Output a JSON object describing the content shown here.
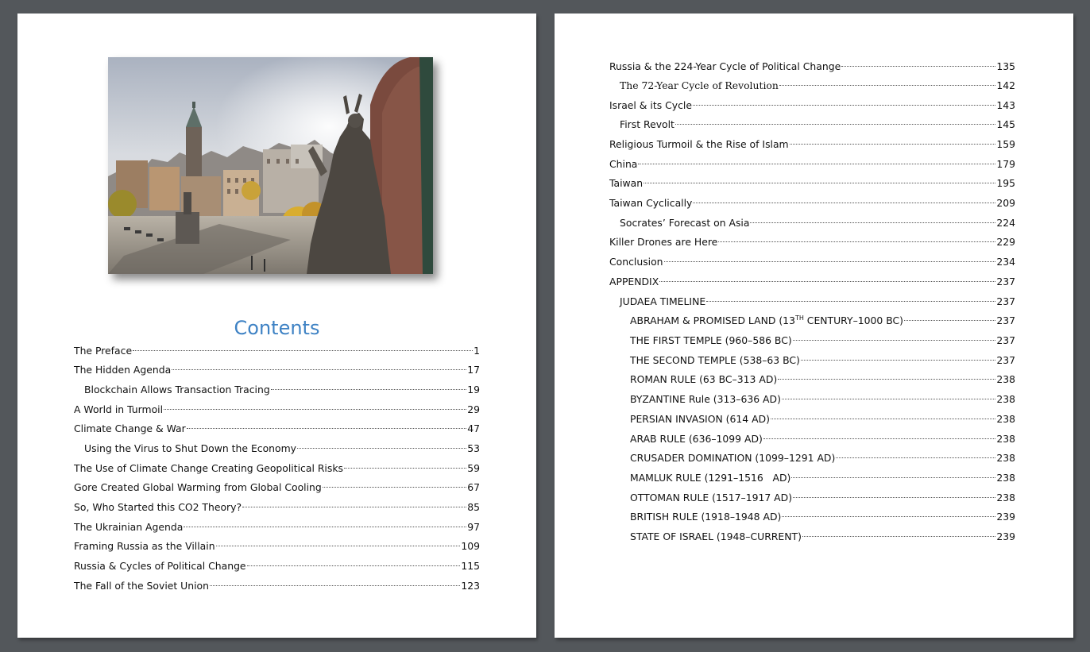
{
  "left_page": {
    "cover_image": "city-statue-photo",
    "contents_title": "Contents",
    "entries": [
      {
        "title": "The Preface",
        "page": "1"
      },
      {
        "title": "The Hidden Agenda",
        "page": "17"
      },
      {
        "title": "Blockchain Allows Transaction Tracing",
        "page": "19"
      },
      {
        "title": "A World in Turmoil",
        "page": "29"
      },
      {
        "title": "Climate Change & War",
        "page": "47"
      },
      {
        "title": "Using the Virus to Shut Down the Economy",
        "page": "53"
      },
      {
        "title": "The Use of Climate Change Creating Geopolitical Risks",
        "page": "59"
      },
      {
        "title": "Gore Created Global Warming from Global Cooling",
        "page": "67"
      },
      {
        "title": "So, Who Started this CO2 Theory?",
        "page": "85"
      },
      {
        "title": "The Ukrainian Agenda",
        "page": "97"
      },
      {
        "title": "Framing Russia as the Villain",
        "page": "109"
      },
      {
        "title": "Russia & Cycles of Political Change",
        "page": "115"
      },
      {
        "title": "The Fall of the Soviet Union",
        "page": "123"
      }
    ]
  },
  "right_page": {
    "entries": [
      {
        "title": "Russia & the 224-Year Cycle of Political Change",
        "page": "135"
      },
      {
        "title": "The 72-Year Cycle of Revolution",
        "page": "142"
      },
      {
        "title": "Israel & its Cycle",
        "page": "143"
      },
      {
        "title": "First Revolt",
        "page": "145"
      },
      {
        "title": "Religious Turmoil & the Rise of Islam",
        "page": "159"
      },
      {
        "title": "China",
        "page": "179"
      },
      {
        "title": "Taiwan",
        "page": "195"
      },
      {
        "title": "Taiwan Cyclically",
        "page": "209"
      },
      {
        "title": "Socrates’ Forecast on Asia",
        "page": "224"
      },
      {
        "title": "Killer Drones are Here",
        "page": "229"
      },
      {
        "title": "Conclusion",
        "page": "234"
      },
      {
        "title": "APPENDIX",
        "page": "237"
      },
      {
        "title": "JUDAEA TIMELINE",
        "page": "237"
      },
      {
        "title_a": "ABRAHAM & PROMISED LAND (13",
        "title_sup": "TH",
        "title_b": " CENTURY–1000 BC)",
        "page": "237"
      },
      {
        "title": "THE FIRST TEMPLE (960–586 BC)",
        "page": "237"
      },
      {
        "title": "THE SECOND TEMPLE (538–63 BC)",
        "page": "237"
      },
      {
        "title": "ROMAN RULE (63 BC–313 AD)",
        "page": "238"
      },
      {
        "title": "BYZANTINE Rule (313–636 AD)",
        "page": "238"
      },
      {
        "title": "PERSIAN INVASION (614 AD)",
        "page": "238"
      },
      {
        "title": "ARAB RULE (636–1099 AD)",
        "page": "238"
      },
      {
        "title": "CRUSADER DOMINATION (1099–1291 AD)",
        "page": "238"
      },
      {
        "title": "MAMLUK RULE (1291–1516   AD)",
        "page": "238"
      },
      {
        "title": "OTTOMAN RULE (1517–1917 AD)",
        "page": "238"
      },
      {
        "title": "BRITISH RULE (1918–1948 AD)",
        "page": "239"
      },
      {
        "title": "STATE OF ISRAEL (1948–CURRENT)",
        "page": "239"
      }
    ]
  },
  "colors": {
    "background": "#53575b",
    "heading": "#3e82c4",
    "page": "#ffffff"
  }
}
